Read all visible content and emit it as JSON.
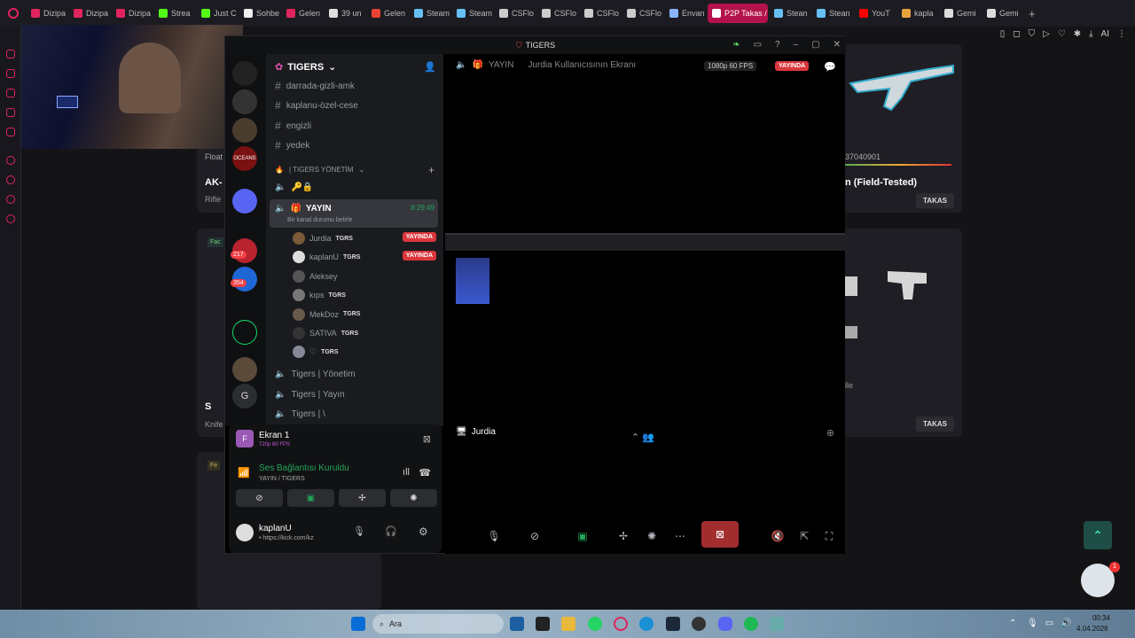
{
  "browser": {
    "tabs": [
      {
        "label": "Dizipa",
        "color": "#e0245e"
      },
      {
        "label": "Dizipa",
        "color": "#e0245e"
      },
      {
        "label": "Dizipa",
        "color": "#e0245e"
      },
      {
        "label": "Strea",
        "color": "#53fc18"
      },
      {
        "label": "Just C",
        "color": "#53fc18"
      },
      {
        "label": "Sohbe",
        "color": "#eeeeee"
      },
      {
        "label": "Gelen",
        "color": "#e0245e"
      },
      {
        "label": "39 un",
        "color": "#dddddd"
      },
      {
        "label": "Gelen",
        "color": "#ea4335"
      },
      {
        "label": "Steam",
        "color": "#66c0f4"
      },
      {
        "label": "Steam",
        "color": "#66c0f4"
      },
      {
        "label": "CSFlo",
        "color": "#cccccc"
      },
      {
        "label": "CSFlo",
        "color": "#cccccc"
      },
      {
        "label": "CSFlo",
        "color": "#cccccc"
      },
      {
        "label": "CSFlo",
        "color": "#cccccc"
      },
      {
        "label": "Envan",
        "color": "#8ab4f8"
      },
      {
        "label": "P2P Takas /",
        "color": "#ffffff",
        "active": true
      },
      {
        "label": "Stean",
        "color": "#66c0f4"
      },
      {
        "label": "Stean",
        "color": "#66c0f4"
      },
      {
        "label": "YouT",
        "color": "#ff0000"
      },
      {
        "label": "kapla",
        "color": "#e8a33d"
      },
      {
        "label": "Gemi",
        "color": "#dddddd"
      },
      {
        "label": "Gemi",
        "color": "#dddddd"
      }
    ]
  },
  "bg_page": {
    "item_name": "n (Field-Tested)",
    "item_code": "37040901",
    "takas_label": "TAKAS",
    "left_title": "AK-",
    "left_sub": "Rifle",
    "left_float": "Float",
    "left_s": "S",
    "left_knife": "Knife",
    "left_fe": "Fe",
    "left_fac": "Fac",
    "card_lle": "lle"
  },
  "discord": {
    "window_title": "TIGERS",
    "server_name": "TIGERS",
    "channels": [
      {
        "name": "darrada-gizli-amk"
      },
      {
        "name": "kaplanu-özel-cese"
      },
      {
        "name": "engizli"
      },
      {
        "name": "yedek"
      }
    ],
    "category": "| TIGERS YÖNETİM",
    "voice_channel": {
      "name": "YAYIN",
      "time": "8:29:49",
      "status": "Bir kanal durumu belirle"
    },
    "users": [
      {
        "name": "Jurdia",
        "tag": "TGRS",
        "live": "YAYINDA"
      },
      {
        "name": "kaplanU",
        "tag": "TGRS",
        "live": "YAYINDA"
      },
      {
        "name": "Aleksey",
        "tag": ""
      },
      {
        "name": "kıps",
        "tag": "TGRS"
      },
      {
        "name": "MekDoz",
        "tag": "TGRS"
      },
      {
        "name": "SATIVA",
        "tag": "TGRS"
      },
      {
        "name": "♡",
        "tag": "TGRS"
      }
    ],
    "other_voice": [
      "Tigers | Yönetim",
      "Tigers | Yayın",
      "Tigers | \\"
    ],
    "server_badges": [
      "217",
      "354"
    ],
    "server_letter": "G",
    "stream_panel": {
      "title": "Ekran 1",
      "quality": "720p 60 FPS",
      "connection": "Ses Bağlantısı Kuruldu",
      "path": "YAYIN / TIGERS"
    },
    "user": {
      "name": "kaplanU",
      "status": "• https://kick.com/kz"
    },
    "stage": {
      "channel": "YAYIN",
      "stream_title": "Jurdia Kullanıcısının Ekranı",
      "fps": "1080p 60 FPS",
      "live": "YAYINDA",
      "streamer": "Jurdia"
    }
  },
  "taskbar": {
    "search": "Ara",
    "time": "00:34",
    "date": "4.04.2026",
    "badge": "1"
  }
}
